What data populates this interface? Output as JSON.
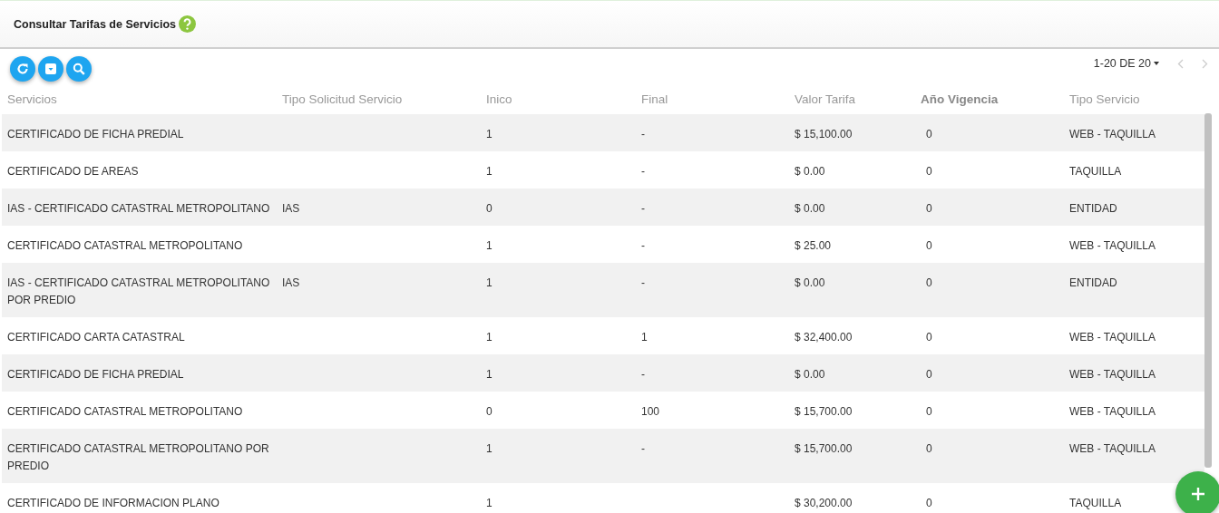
{
  "header": {
    "title": "Consultar Tarifas de Servicios"
  },
  "pagination": {
    "range": "1-20 DE 20"
  },
  "table": {
    "columns": [
      {
        "label": "Servicios",
        "bold": false
      },
      {
        "label": "Tipo Solicitud Servicio",
        "bold": false
      },
      {
        "label": "Inico",
        "bold": false
      },
      {
        "label": "Final",
        "bold": false
      },
      {
        "label": "Valor Tarifa",
        "bold": false
      },
      {
        "label": "Año Vigencia",
        "bold": true
      },
      {
        "label": "Tipo Servicio",
        "bold": false
      }
    ],
    "rows": [
      {
        "cells": [
          "CERTIFICADO DE FICHA PREDIAL",
          null,
          "1",
          "-",
          "$ 15,100.00",
          "0",
          "WEB - TAQUILLA"
        ]
      },
      {
        "cells": [
          "CERTIFICADO DE AREAS",
          null,
          "1",
          "-",
          "$ 0.00",
          "0",
          "TAQUILLA"
        ]
      },
      {
        "cells": [
          "IAS - CERTIFICADO CATASTRAL METROPOLITANO",
          "IAS",
          "0",
          "-",
          "$ 0.00",
          "0",
          "ENTIDAD"
        ]
      },
      {
        "cells": [
          "CERTIFICADO CATASTRAL METROPOLITANO",
          null,
          "1",
          "-",
          "$ 25.00",
          "0",
          "WEB - TAQUILLA"
        ]
      },
      {
        "cells": [
          "IAS - CERTIFICADO CATASTRAL METROPOLITANO POR PREDIO",
          "IAS",
          "1",
          "-",
          "$ 0.00",
          "0",
          "ENTIDAD"
        ]
      },
      {
        "cells": [
          "CERTIFICADO CARTA CATASTRAL",
          null,
          "1",
          "1",
          "$ 32,400.00",
          "0",
          "WEB - TAQUILLA"
        ]
      },
      {
        "cells": [
          "CERTIFICADO DE FICHA PREDIAL",
          null,
          "1",
          "-",
          "$ 0.00",
          "0",
          "WEB - TAQUILLA"
        ]
      },
      {
        "cells": [
          "CERTIFICADO CATASTRAL METROPOLITANO",
          null,
          "0",
          "100",
          "$ 15,700.00",
          "0",
          "WEB - TAQUILLA"
        ]
      },
      {
        "cells": [
          "CERTIFICADO CATASTRAL METROPOLITANO POR PREDIO",
          null,
          "1",
          "-",
          "$ 15,700.00",
          "0",
          "WEB - TAQUILLA"
        ]
      },
      {
        "cells": [
          "CERTIFICADO DE INFORMACION PLANO",
          null,
          "1",
          null,
          "$ 30,200.00",
          "0",
          "TAQUILLA"
        ]
      }
    ]
  }
}
